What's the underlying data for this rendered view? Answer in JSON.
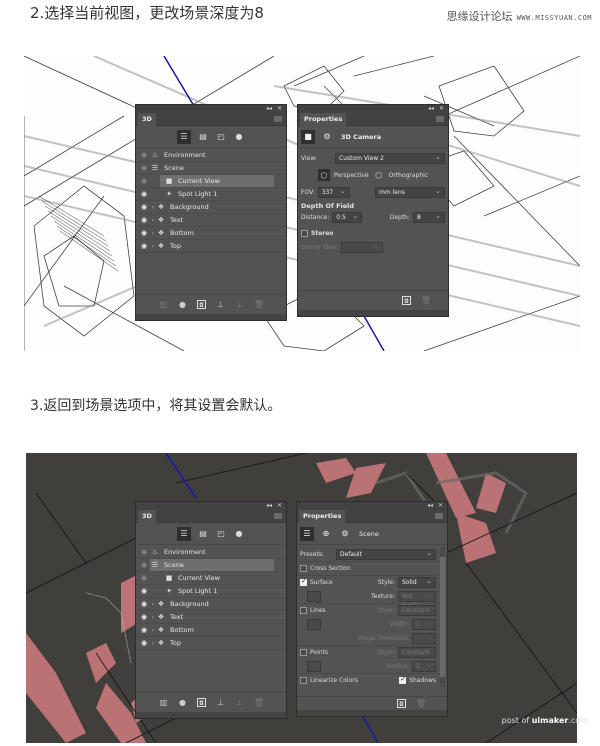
{
  "step2": {
    "title": "2.选择当前视图，更改场景深度为8",
    "watermark_site": "思缘设计论坛",
    "watermark_url": "WWW.MISSYUAN.COM"
  },
  "step3": {
    "title": "3.返回到场景选项中，将其设置会默认。"
  },
  "panel3d": {
    "tab": "3D",
    "collapse_icon": "collapse-icon",
    "close_icon": "close-icon",
    "filter_icons": [
      "whole-scene-icon",
      "meshes-icon",
      "materials-icon",
      "lights-icon"
    ],
    "layers": [
      {
        "label": "Environment",
        "icon": "environment-icon",
        "eye": "dim"
      },
      {
        "label": "Scene",
        "icon": "scene-icon",
        "eye": "dim"
      },
      {
        "label": "Current View",
        "icon": "camera-icon",
        "eye": "dim"
      },
      {
        "label": "Spot Light 1",
        "icon": "spotlight-icon",
        "eye": "on"
      },
      {
        "label": "Background",
        "icon": "mesh-icon",
        "eye": "on",
        "expandable": true
      },
      {
        "label": "Text",
        "icon": "mesh-icon",
        "eye": "on",
        "expandable": true
      },
      {
        "label": "Bottom",
        "icon": "mesh-icon",
        "eye": "on",
        "expandable": true
      },
      {
        "label": "Top",
        "icon": "mesh-icon",
        "eye": "on",
        "expandable": true
      }
    ],
    "bottom_icons": [
      "add-mesh-icon",
      "add-light-icon",
      "render-icon",
      "drop-to-ground-icon",
      "move-to-origin-icon",
      "delete-icon"
    ]
  },
  "view1": {
    "selected_layer": "Current View",
    "properties": {
      "tab": "Properties",
      "title": "3D Camera",
      "view_label": "View:",
      "view_value": "Custom View 2",
      "perspective_label": "Perspective",
      "orthographic_label": "Orthographic",
      "fov_label": "FOV:",
      "fov_value": "337",
      "fov_unit": "mm lens",
      "dof_title": "Depth Of Field",
      "distance_label": "Distance:",
      "distance_value": "0.5",
      "depth_label": "Depth:",
      "depth_value": "8",
      "stereo_label": "Stereo",
      "stereo_checked": false,
      "stereo_view_label": "Stereo View:",
      "stereo_view_value": ""
    }
  },
  "view2": {
    "selected_layer": "Scene",
    "properties": {
      "tab": "Properties",
      "title": "Scene",
      "presets_label": "Presets:",
      "presets_value": "Default",
      "cross_section_label": "Cross Section",
      "cross_section_checked": false,
      "surface_label": "Surface",
      "surface_checked": true,
      "style_label": "Style:",
      "surface_style": "Solid",
      "texture_label": "Texture:",
      "texture_value": "Not Availa...",
      "lines_label": "Lines",
      "lines_checked": false,
      "lines_style": "Constant",
      "width_label": "Width:",
      "width_value": "1",
      "angle_label": "Angle Threshold:",
      "angle_value": "",
      "points_label": "Points",
      "points_checked": false,
      "points_style": "Constant",
      "radius_label": "Radius:",
      "radius_value": "1",
      "linearize_label": "Linearize Colors",
      "linearize_checked": false,
      "shadows_label": "Shadows",
      "shadows_checked": true
    }
  },
  "watermark_bottom": {
    "prefix": "post of ",
    "brand": "uimaker",
    "suffix": ".com"
  },
  "colors": {
    "panel_bg": "#535353",
    "panel_header": "#424242",
    "selection": "#6e6e6e",
    "scene2_bg": "#403f3c",
    "text_pink": "#c8787c",
    "axis_blue": "#1a1aa0"
  }
}
